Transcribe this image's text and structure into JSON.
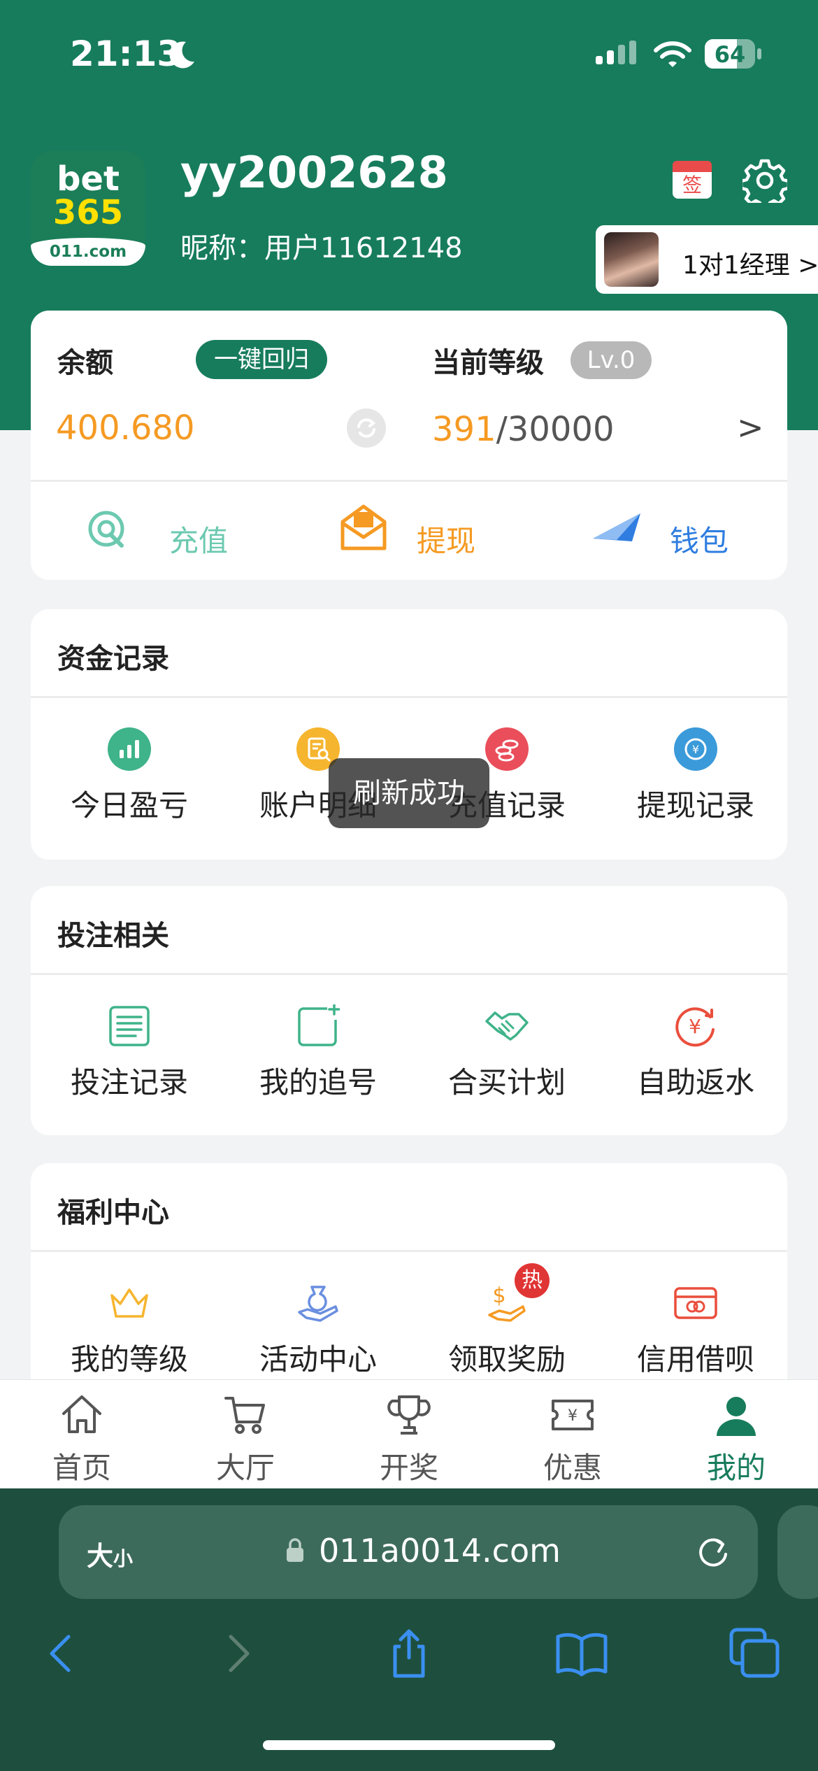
{
  "status_bar": {
    "time": "21:13",
    "battery": "64",
    "battery_level": 0.64
  },
  "profile": {
    "logo": {
      "line1": "bet",
      "line2": "365",
      "line3": "011.com"
    },
    "username": "yy2002628",
    "nickname": "昵称：用户11612148",
    "sign_icon_text": "签",
    "manager_label": "1对1经理 >"
  },
  "balance_card": {
    "balance_label": "余额",
    "reset_label": "一键回归",
    "balance_value": "400.680",
    "level_label": "当前等级",
    "level_badge": "Lv.0",
    "level_current": "391",
    "level_total": "/30000",
    "level_arrow": ">",
    "actions": [
      {
        "label": "充值",
        "color": "#6cc9b0"
      },
      {
        "label": "提现",
        "color": "#f59a23"
      },
      {
        "label": "钱包",
        "color": "#2f7de0"
      }
    ]
  },
  "sections": {
    "funds": {
      "title": "资金记录",
      "items": [
        {
          "label": "今日盈亏",
          "icon": "bar-chart-icon",
          "color": "#3fb38a"
        },
        {
          "label": "账户明细",
          "icon": "document-search-icon",
          "color": "#f6b52e"
        },
        {
          "label": "充值记录",
          "icon": "coins-icon",
          "color": "#ea4e5a"
        },
        {
          "label": "提现记录",
          "icon": "yuan-cycle-icon",
          "color": "#3b9ad9"
        }
      ]
    },
    "betting": {
      "title": "投注相关",
      "items": [
        {
          "label": "投注记录",
          "icon": "list-icon",
          "color": "#3fb38a"
        },
        {
          "label": "我的追号",
          "icon": "add-square-icon",
          "color": "#3fb38a"
        },
        {
          "label": "合买计划",
          "icon": "handshake-icon",
          "color": "#3fb38a"
        },
        {
          "label": "自助返水",
          "icon": "yuan-refresh-icon",
          "color": "#ea4e3c"
        }
      ]
    },
    "welfare": {
      "title": "福利中心",
      "items": [
        {
          "label": "我的等级",
          "icon": "crown-icon",
          "color": "#f6b52e"
        },
        {
          "label": "活动中心",
          "icon": "gift-hand-icon",
          "color": "#6a8fe0"
        },
        {
          "label": "领取奖励",
          "icon": "money-bag-icon",
          "color": "#f59a23",
          "badge": "热"
        },
        {
          "label": "信用借呗",
          "icon": "credit-card-icon",
          "color": "#ea4e3c"
        }
      ]
    }
  },
  "toast": "刷新成功",
  "tabs": [
    {
      "label": "首页",
      "icon": "home-icon"
    },
    {
      "label": "大厅",
      "icon": "cart-icon"
    },
    {
      "label": "开奖",
      "icon": "trophy-icon"
    },
    {
      "label": "优惠",
      "icon": "ticket-icon"
    },
    {
      "label": "我的",
      "icon": "user-icon",
      "active": true
    }
  ],
  "browser": {
    "text_size_main": "大",
    "text_size_small": "小",
    "url": "011a0014.com"
  },
  "colors": {
    "brand": "#177c5c",
    "accent": "#f59a23"
  }
}
